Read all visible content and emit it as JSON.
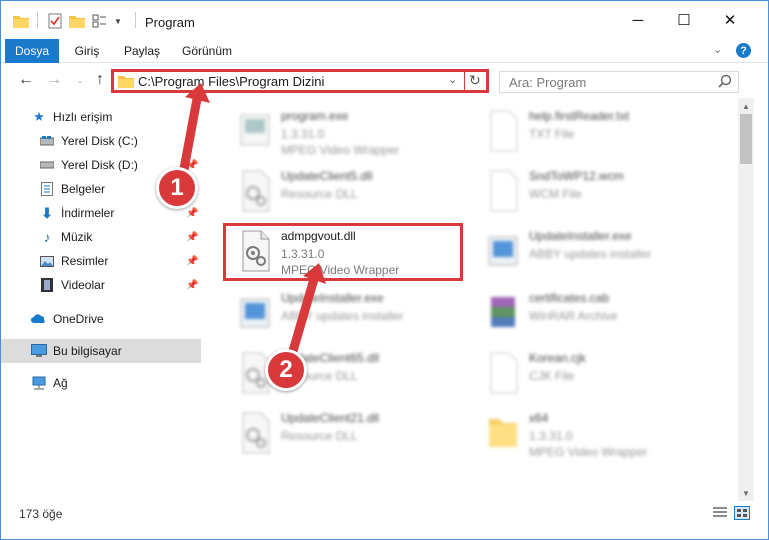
{
  "window": {
    "title": "Program",
    "controls": {
      "minimize": "─",
      "maximize": "☐",
      "close": "✕"
    }
  },
  "ribbon": {
    "tabs": [
      {
        "label": "Dosya",
        "active": true
      },
      {
        "label": "Giriş",
        "active": false
      },
      {
        "label": "Paylaş",
        "active": false
      },
      {
        "label": "Görünüm",
        "active": false
      }
    ]
  },
  "address": {
    "path": "C:\\Program Files\\Program Dizini",
    "search_placeholder": "Ara: Program"
  },
  "sidebar": {
    "items": [
      {
        "label": "Hızlı erişim",
        "icon": "star-icon",
        "pinned": false
      },
      {
        "label": "Yerel Disk (C:)",
        "icon": "drive-icon",
        "pinned": false
      },
      {
        "label": "Yerel Disk (D:)",
        "icon": "drive-icon",
        "pinned": true
      },
      {
        "label": "Belgeler",
        "icon": "documents-icon",
        "pinned": true
      },
      {
        "label": "İndirmeler",
        "icon": "download-icon",
        "pinned": true
      },
      {
        "label": "Müzik",
        "icon": "music-icon",
        "pinned": true
      },
      {
        "label": "Resimler",
        "icon": "pictures-icon",
        "pinned": true
      },
      {
        "label": "Videolar",
        "icon": "videos-icon",
        "pinned": true
      },
      {
        "label": "OneDrive",
        "icon": "cloud-icon",
        "pinned": false
      },
      {
        "label": "Bu bilgisayar",
        "icon": "computer-icon",
        "pinned": false,
        "selected": true
      },
      {
        "label": "Ağ",
        "icon": "network-icon",
        "pinned": false
      }
    ]
  },
  "files": [
    {
      "name": "program.exe",
      "line1": "1.3.31.0",
      "line2": "MPEG Video Wrapper",
      "icon": "exe-icon",
      "blurred": true
    },
    {
      "name": "help.firstReader.txt",
      "line1": "TXT File",
      "line2": "",
      "icon": "text-file-icon",
      "blurred": true
    },
    {
      "name": "UpdateClient5.dll",
      "line1": "Resource DLL",
      "line2": "",
      "icon": "dll-icon",
      "blurred": true
    },
    {
      "name": "SndToWP12.wcm",
      "line1": "WCM File",
      "line2": "",
      "icon": "blank-file-icon",
      "blurred": true
    },
    {
      "name": "admpgvout.dll",
      "line1": "1.3.31.0",
      "line2": "MPEG Video Wrapper",
      "icon": "dll-icon",
      "blurred": false,
      "highlighted": true
    },
    {
      "name": "UpdateInstaller.exe",
      "line1": "ABBY updates installer",
      "line2": "",
      "icon": "installer-icon",
      "blurred": true
    },
    {
      "name": "UpdateInstaller.exe",
      "line1": "ABBY updates installer",
      "line2": "",
      "icon": "installer-icon",
      "blurred": true
    },
    {
      "name": "certificates.cab",
      "line1": "WinRAR Archive",
      "line2": "",
      "icon": "archive-icon",
      "blurred": true
    },
    {
      "name": "UpdateClient65.dll",
      "line1": "Resource DLL",
      "line2": "",
      "icon": "dll-icon",
      "blurred": true
    },
    {
      "name": "Korean.cjk",
      "line1": "CJK File",
      "line2": "",
      "icon": "blank-file-icon",
      "blurred": true
    },
    {
      "name": "UpdateClient21.dll",
      "line1": "Resource DLL",
      "line2": "",
      "icon": "dll-icon",
      "blurred": true
    },
    {
      "name": "x64",
      "line1": "1.3.31.0",
      "line2": "MPEG Video Wrapper",
      "icon": "folder-icon",
      "blurred": true
    }
  ],
  "status": {
    "item_count": "173 öğe"
  },
  "annotations": {
    "step1": "1",
    "step2": "2"
  },
  "colors": {
    "accent": "#1979ca",
    "highlight": "#d9393b",
    "selection": "#dcdcdc"
  }
}
